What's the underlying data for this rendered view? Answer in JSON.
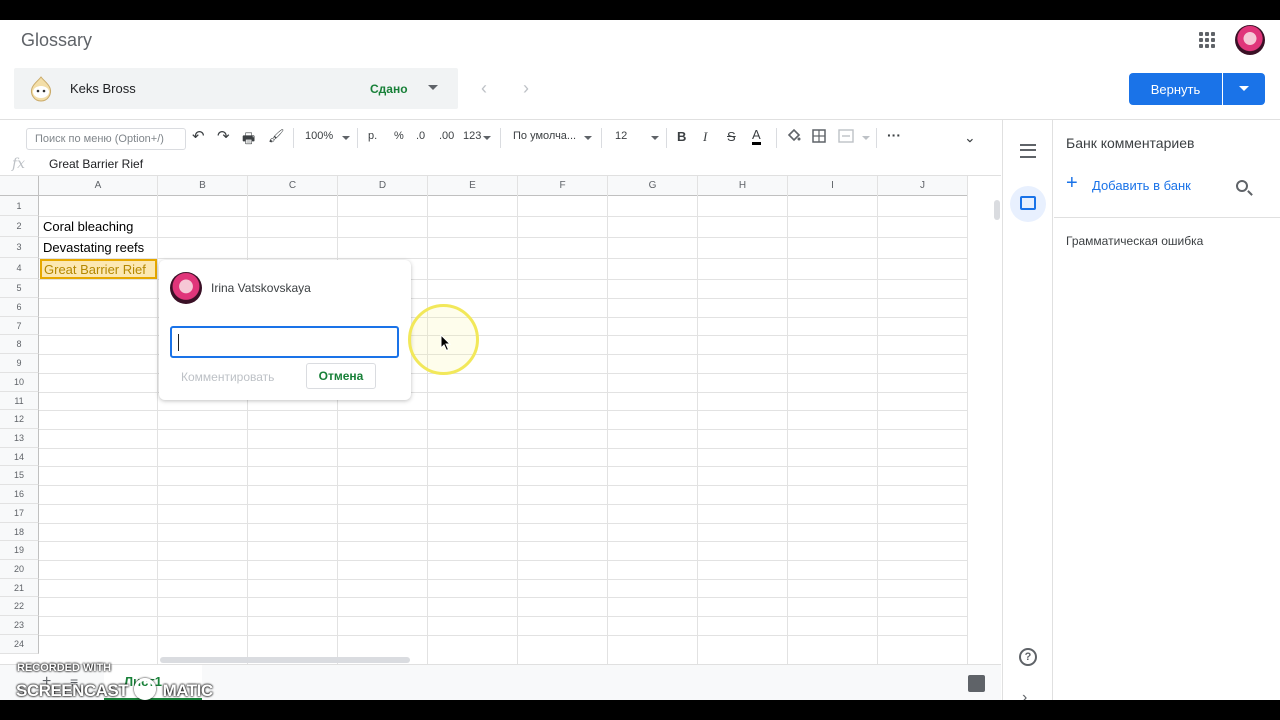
{
  "header": {
    "app_title": "Glossary",
    "apps_icon": "apps-grid-icon",
    "account_icon": "account-avatar"
  },
  "student_bar": {
    "student_name": "Keks Bross",
    "status": "Сдано",
    "prev_icon": "chevron-left-icon",
    "next_icon": "chevron-right-icon"
  },
  "actions": {
    "return_label": "Вернуть"
  },
  "toolbar": {
    "menu_search_placeholder": "Поиск по меню (Option+/)",
    "undo": "↶",
    "redo": "↷",
    "print": "🖶",
    "paint_format": "🖌",
    "zoom": "100%",
    "currency": "р.",
    "percent": "%",
    "decimal_decrease": ".0",
    "decimal_increase": ".00",
    "number_format": "123",
    "font": "По умолча...",
    "font_size": "12",
    "bold": "B",
    "italic": "I",
    "strikethrough": "S",
    "text_color": "A",
    "more": "···",
    "collapse": "⌃"
  },
  "formula_bar": {
    "fx": "fx",
    "value": "Great Barrier Rief"
  },
  "grid": {
    "columns": [
      "A",
      "B",
      "C",
      "D",
      "E",
      "F",
      "G",
      "H",
      "I",
      "J"
    ],
    "rows": [
      "1",
      "2",
      "3",
      "4",
      "5",
      "6",
      "7",
      "8",
      "9",
      "10",
      "11",
      "12",
      "13",
      "14",
      "15",
      "16",
      "17",
      "18",
      "19",
      "20",
      "21",
      "22",
      "23",
      "24"
    ],
    "cells": {
      "A2": "Coral bleaching",
      "A3": "Devastating reefs",
      "A4": "Great Barrier Rief"
    }
  },
  "comment_popup": {
    "user_name": "Irina Vatskovskaya",
    "input_value": "",
    "submit_label": "Комментировать",
    "cancel_label": "Отмена"
  },
  "sheet_tabs": {
    "add": "+",
    "list": "≡",
    "active_tab": "Лист1"
  },
  "comment_bank": {
    "title": "Банк комментариев",
    "add_label": "Добавить в банк",
    "items": [
      "Грамматическая ошибка"
    ]
  },
  "watermark": {
    "line1": "RECORDED WITH",
    "line2": "SCREENCAST",
    "line3": "MATIC"
  },
  "colors": {
    "accent": "#1a73e8",
    "status_green": "#188038",
    "selected_cell": "#fce8b2"
  }
}
